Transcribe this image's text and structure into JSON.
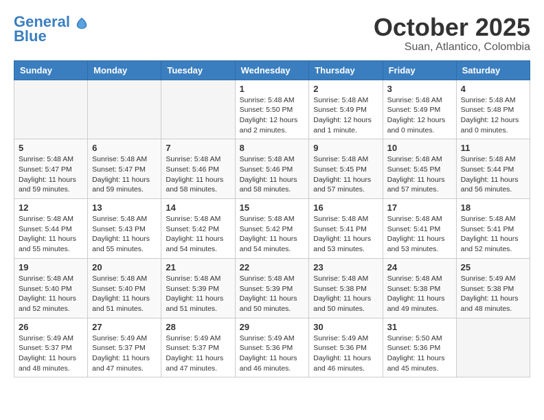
{
  "header": {
    "logo_line1": "General",
    "logo_line2": "Blue",
    "month_year": "October 2025",
    "location": "Suan, Atlantico, Colombia"
  },
  "weekdays": [
    "Sunday",
    "Monday",
    "Tuesday",
    "Wednesday",
    "Thursday",
    "Friday",
    "Saturday"
  ],
  "weeks": [
    [
      {
        "day": "",
        "sunrise": "",
        "sunset": "",
        "daylight": ""
      },
      {
        "day": "",
        "sunrise": "",
        "sunset": "",
        "daylight": ""
      },
      {
        "day": "",
        "sunrise": "",
        "sunset": "",
        "daylight": ""
      },
      {
        "day": "1",
        "sunrise": "Sunrise: 5:48 AM",
        "sunset": "Sunset: 5:50 PM",
        "daylight": "Daylight: 12 hours and 2 minutes."
      },
      {
        "day": "2",
        "sunrise": "Sunrise: 5:48 AM",
        "sunset": "Sunset: 5:49 PM",
        "daylight": "Daylight: 12 hours and 1 minute."
      },
      {
        "day": "3",
        "sunrise": "Sunrise: 5:48 AM",
        "sunset": "Sunset: 5:49 PM",
        "daylight": "Daylight: 12 hours and 0 minutes."
      },
      {
        "day": "4",
        "sunrise": "Sunrise: 5:48 AM",
        "sunset": "Sunset: 5:48 PM",
        "daylight": "Daylight: 12 hours and 0 minutes."
      }
    ],
    [
      {
        "day": "5",
        "sunrise": "Sunrise: 5:48 AM",
        "sunset": "Sunset: 5:47 PM",
        "daylight": "Daylight: 11 hours and 59 minutes."
      },
      {
        "day": "6",
        "sunrise": "Sunrise: 5:48 AM",
        "sunset": "Sunset: 5:47 PM",
        "daylight": "Daylight: 11 hours and 59 minutes."
      },
      {
        "day": "7",
        "sunrise": "Sunrise: 5:48 AM",
        "sunset": "Sunset: 5:46 PM",
        "daylight": "Daylight: 11 hours and 58 minutes."
      },
      {
        "day": "8",
        "sunrise": "Sunrise: 5:48 AM",
        "sunset": "Sunset: 5:46 PM",
        "daylight": "Daylight: 11 hours and 58 minutes."
      },
      {
        "day": "9",
        "sunrise": "Sunrise: 5:48 AM",
        "sunset": "Sunset: 5:45 PM",
        "daylight": "Daylight: 11 hours and 57 minutes."
      },
      {
        "day": "10",
        "sunrise": "Sunrise: 5:48 AM",
        "sunset": "Sunset: 5:45 PM",
        "daylight": "Daylight: 11 hours and 57 minutes."
      },
      {
        "day": "11",
        "sunrise": "Sunrise: 5:48 AM",
        "sunset": "Sunset: 5:44 PM",
        "daylight": "Daylight: 11 hours and 56 minutes."
      }
    ],
    [
      {
        "day": "12",
        "sunrise": "Sunrise: 5:48 AM",
        "sunset": "Sunset: 5:44 PM",
        "daylight": "Daylight: 11 hours and 55 minutes."
      },
      {
        "day": "13",
        "sunrise": "Sunrise: 5:48 AM",
        "sunset": "Sunset: 5:43 PM",
        "daylight": "Daylight: 11 hours and 55 minutes."
      },
      {
        "day": "14",
        "sunrise": "Sunrise: 5:48 AM",
        "sunset": "Sunset: 5:42 PM",
        "daylight": "Daylight: 11 hours and 54 minutes."
      },
      {
        "day": "15",
        "sunrise": "Sunrise: 5:48 AM",
        "sunset": "Sunset: 5:42 PM",
        "daylight": "Daylight: 11 hours and 54 minutes."
      },
      {
        "day": "16",
        "sunrise": "Sunrise: 5:48 AM",
        "sunset": "Sunset: 5:41 PM",
        "daylight": "Daylight: 11 hours and 53 minutes."
      },
      {
        "day": "17",
        "sunrise": "Sunrise: 5:48 AM",
        "sunset": "Sunset: 5:41 PM",
        "daylight": "Daylight: 11 hours and 53 minutes."
      },
      {
        "day": "18",
        "sunrise": "Sunrise: 5:48 AM",
        "sunset": "Sunset: 5:41 PM",
        "daylight": "Daylight: 11 hours and 52 minutes."
      }
    ],
    [
      {
        "day": "19",
        "sunrise": "Sunrise: 5:48 AM",
        "sunset": "Sunset: 5:40 PM",
        "daylight": "Daylight: 11 hours and 52 minutes."
      },
      {
        "day": "20",
        "sunrise": "Sunrise: 5:48 AM",
        "sunset": "Sunset: 5:40 PM",
        "daylight": "Daylight: 11 hours and 51 minutes."
      },
      {
        "day": "21",
        "sunrise": "Sunrise: 5:48 AM",
        "sunset": "Sunset: 5:39 PM",
        "daylight": "Daylight: 11 hours and 51 minutes."
      },
      {
        "day": "22",
        "sunrise": "Sunrise: 5:48 AM",
        "sunset": "Sunset: 5:39 PM",
        "daylight": "Daylight: 11 hours and 50 minutes."
      },
      {
        "day": "23",
        "sunrise": "Sunrise: 5:48 AM",
        "sunset": "Sunset: 5:38 PM",
        "daylight": "Daylight: 11 hours and 50 minutes."
      },
      {
        "day": "24",
        "sunrise": "Sunrise: 5:48 AM",
        "sunset": "Sunset: 5:38 PM",
        "daylight": "Daylight: 11 hours and 49 minutes."
      },
      {
        "day": "25",
        "sunrise": "Sunrise: 5:49 AM",
        "sunset": "Sunset: 5:38 PM",
        "daylight": "Daylight: 11 hours and 48 minutes."
      }
    ],
    [
      {
        "day": "26",
        "sunrise": "Sunrise: 5:49 AM",
        "sunset": "Sunset: 5:37 PM",
        "daylight": "Daylight: 11 hours and 48 minutes."
      },
      {
        "day": "27",
        "sunrise": "Sunrise: 5:49 AM",
        "sunset": "Sunset: 5:37 PM",
        "daylight": "Daylight: 11 hours and 47 minutes."
      },
      {
        "day": "28",
        "sunrise": "Sunrise: 5:49 AM",
        "sunset": "Sunset: 5:37 PM",
        "daylight": "Daylight: 11 hours and 47 minutes."
      },
      {
        "day": "29",
        "sunrise": "Sunrise: 5:49 AM",
        "sunset": "Sunset: 5:36 PM",
        "daylight": "Daylight: 11 hours and 46 minutes."
      },
      {
        "day": "30",
        "sunrise": "Sunrise: 5:49 AM",
        "sunset": "Sunset: 5:36 PM",
        "daylight": "Daylight: 11 hours and 46 minutes."
      },
      {
        "day": "31",
        "sunrise": "Sunrise: 5:50 AM",
        "sunset": "Sunset: 5:36 PM",
        "daylight": "Daylight: 11 hours and 45 minutes."
      },
      {
        "day": "",
        "sunrise": "",
        "sunset": "",
        "daylight": ""
      }
    ]
  ]
}
